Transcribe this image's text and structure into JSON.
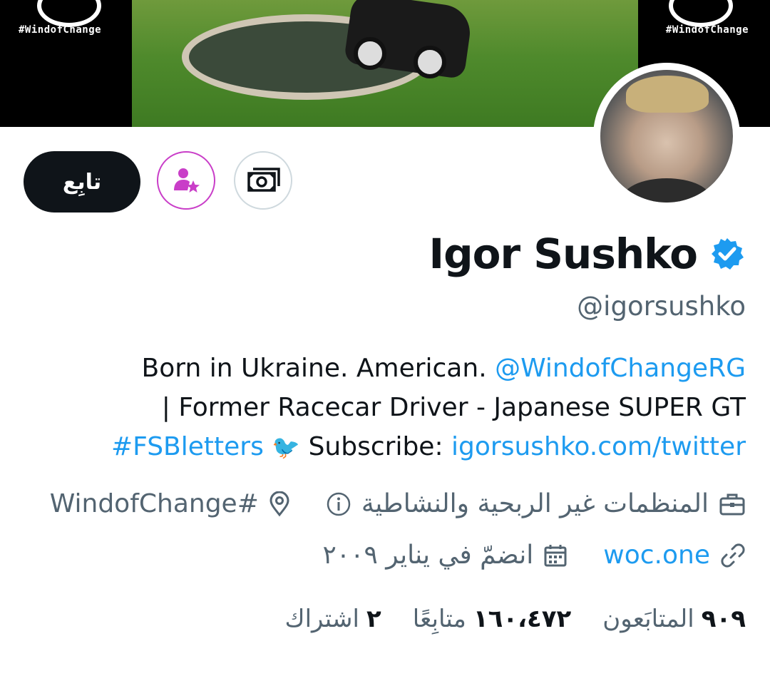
{
  "banner": {
    "hashtag_left": "#WindofChange",
    "hashtag_right": "#WindofChange"
  },
  "profile": {
    "name": "Igor Sushko",
    "verified_icon": "verified-badge-icon",
    "handle": "@igorsushko"
  },
  "actions": {
    "follow_label": "تابِع",
    "subscribe_icon": "person-star-icon",
    "tips_icon": "money-icon"
  },
  "bio": {
    "line1_text": "Born in Ukraine. American. ",
    "line1_link": "@WindofChangeRG",
    "line2_text": "| Former Racecar Driver - Japanese SUPER GT",
    "line3_hashtag": "#FSBletters",
    "line3_emoji": "🐦",
    "line3_text": " Subscribe: ",
    "line3_link": "igorsushko.com/twitter"
  },
  "meta": {
    "category": "المنظمات غير الربحية والنشاطية",
    "location": "#WindofChange",
    "website": "woc.one",
    "joined": "انضمّ في يناير ٢٠٠٩"
  },
  "stats": {
    "followers_count": "٩٠٩",
    "followers_label": "المتابَعون",
    "following_count": "١٦٠،٤٧٢",
    "following_label": "متابِعًا",
    "subscriptions_count": "٢",
    "subscriptions_label": "اشتراك"
  },
  "colors": {
    "link": "#1d9bf0",
    "secondary_text": "#536471",
    "primary_text": "#0f1419",
    "subscribe_accent": "#c93ec8",
    "verified": "#1d9bf0"
  }
}
